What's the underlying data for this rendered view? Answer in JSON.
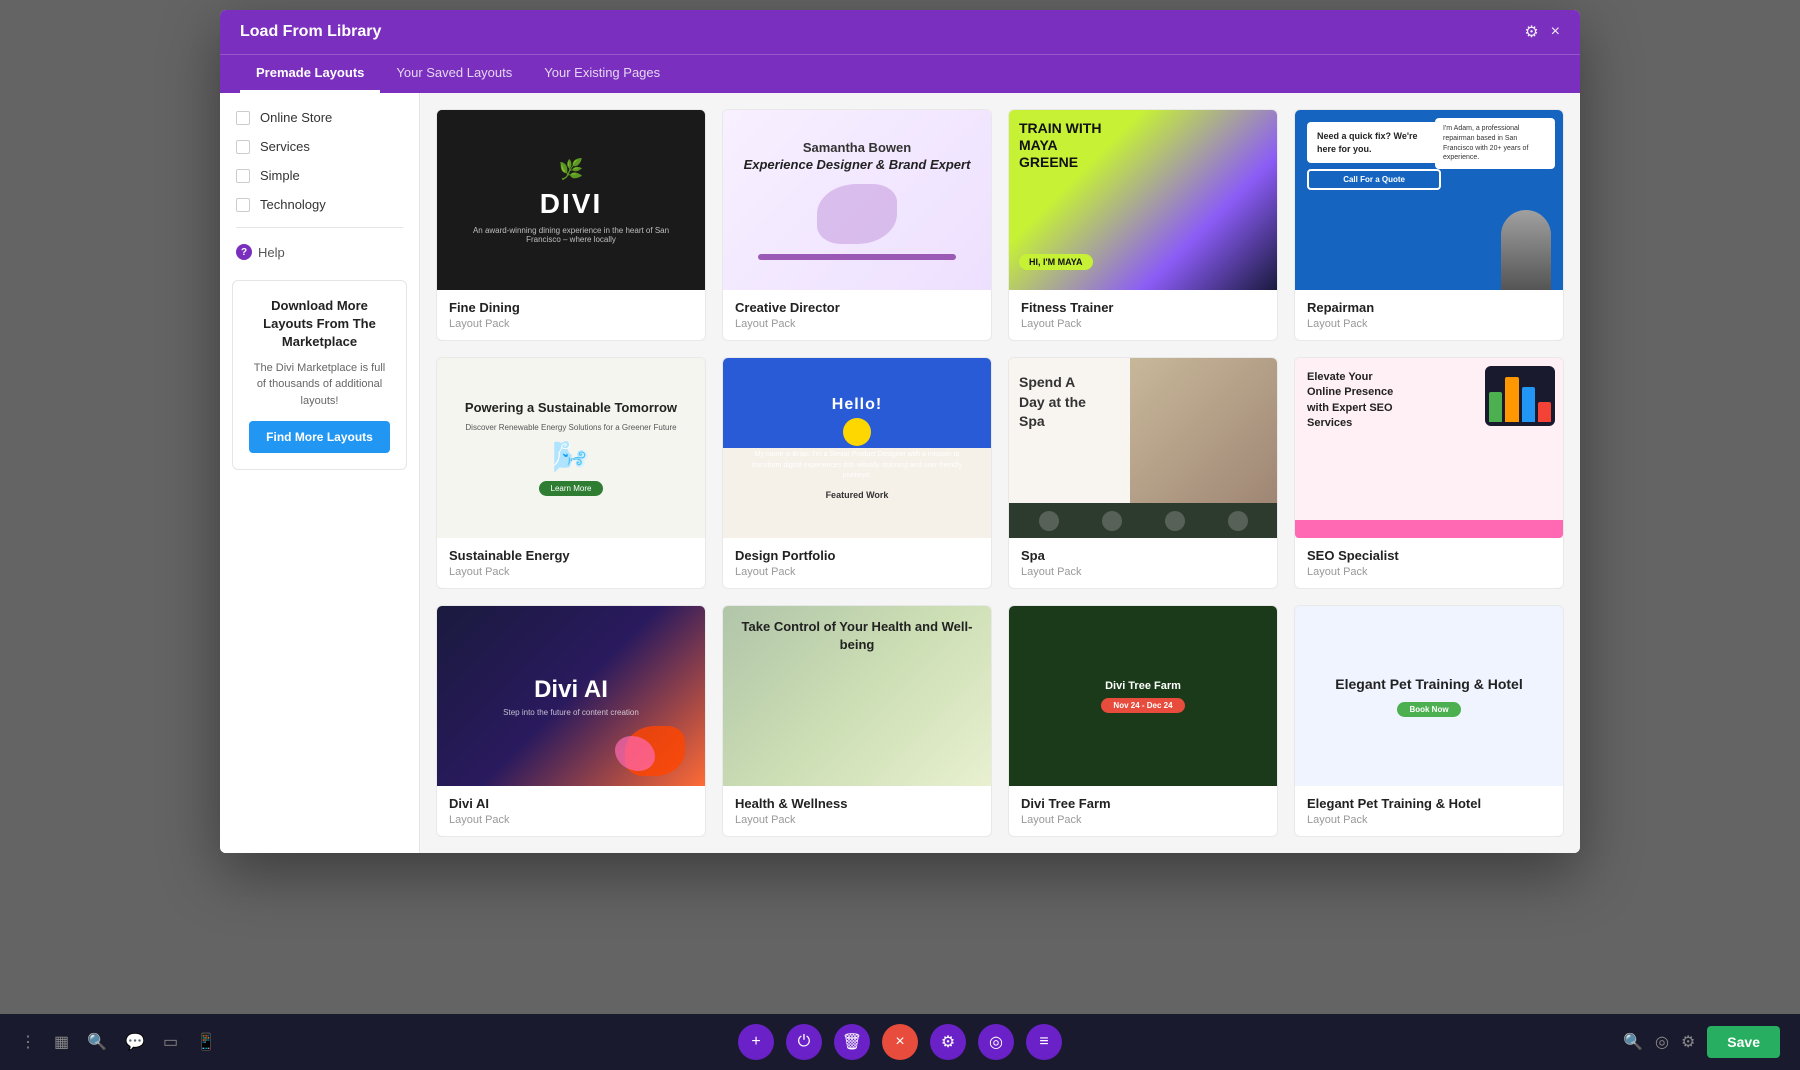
{
  "modal": {
    "title": "Load From Library",
    "tabs": [
      {
        "label": "Premade Layouts",
        "active": true
      },
      {
        "label": "Your Saved Layouts",
        "active": false
      },
      {
        "label": "Your Existing Pages",
        "active": false
      }
    ],
    "close_btn": "×",
    "settings_icon": "⚙"
  },
  "sidebar": {
    "items": [
      {
        "label": "Online Store"
      },
      {
        "label": "Services"
      },
      {
        "label": "Simple"
      },
      {
        "label": "Technology"
      }
    ],
    "help_label": "Help",
    "cta": {
      "title": "Download More Layouts From The Marketplace",
      "text": "The Divi Marketplace is full of thousands of additional layouts!",
      "button_label": "Find More Layouts"
    }
  },
  "layouts": [
    {
      "name": "Fine Dining",
      "type": "Layout Pack",
      "thumb_type": "fine-dining"
    },
    {
      "name": "Creative Director",
      "type": "Layout Pack",
      "thumb_type": "creative-director"
    },
    {
      "name": "Fitness Trainer",
      "type": "Layout Pack",
      "thumb_type": "fitness-trainer"
    },
    {
      "name": "Repairman",
      "type": "Layout Pack",
      "thumb_type": "repairman"
    },
    {
      "name": "Sustainable Energy",
      "type": "Layout Pack",
      "thumb_type": "sustainable-energy"
    },
    {
      "name": "Design Portfolio",
      "type": "Layout Pack",
      "thumb_type": "design-portfolio"
    },
    {
      "name": "Spa",
      "type": "Layout Pack",
      "thumb_type": "spa"
    },
    {
      "name": "SEO Specialist",
      "type": "Layout Pack",
      "thumb_type": "seo-specialist"
    },
    {
      "name": "Divi AI",
      "type": "Layout Pack",
      "thumb_type": "divi-ai"
    },
    {
      "name": "Health & Wellness",
      "type": "Layout Pack",
      "thumb_type": "health"
    },
    {
      "name": "Divi Tree Farm",
      "type": "Layout Pack",
      "thumb_type": "tree-farm"
    },
    {
      "name": "Elegant Pet Training & Hotel",
      "type": "Layout Pack",
      "thumb_type": "pet-hotel"
    }
  ],
  "toolbar": {
    "add_icon": "+",
    "power_icon": "⏻",
    "trash_icon": "🗑",
    "close_icon": "×",
    "settings_icon": "⚙",
    "circle_icon": "◎",
    "bars_icon": "≡",
    "save_label": "Save",
    "dot_icon": "⋮",
    "grid_icon": "▦",
    "search_icon": "🔍",
    "chat_icon": "💬",
    "tablet_icon": "▭",
    "phone_icon": "📱"
  }
}
